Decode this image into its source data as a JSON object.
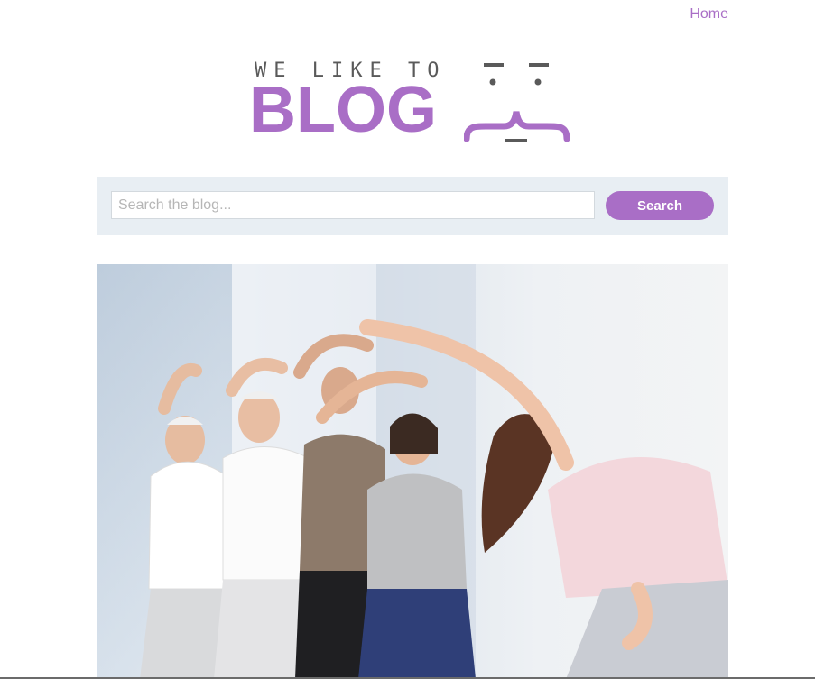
{
  "nav": {
    "home_label": "Home"
  },
  "logo": {
    "tagline": "WE LIKE TO",
    "word": "BLOG"
  },
  "search": {
    "placeholder": "Search the blog...",
    "value": "",
    "button_label": "Search"
  },
  "hero": {
    "alt": "fitness-class-stretching-photo"
  },
  "colors": {
    "accent": "#a96ec6",
    "panel": "#e8eef3"
  }
}
